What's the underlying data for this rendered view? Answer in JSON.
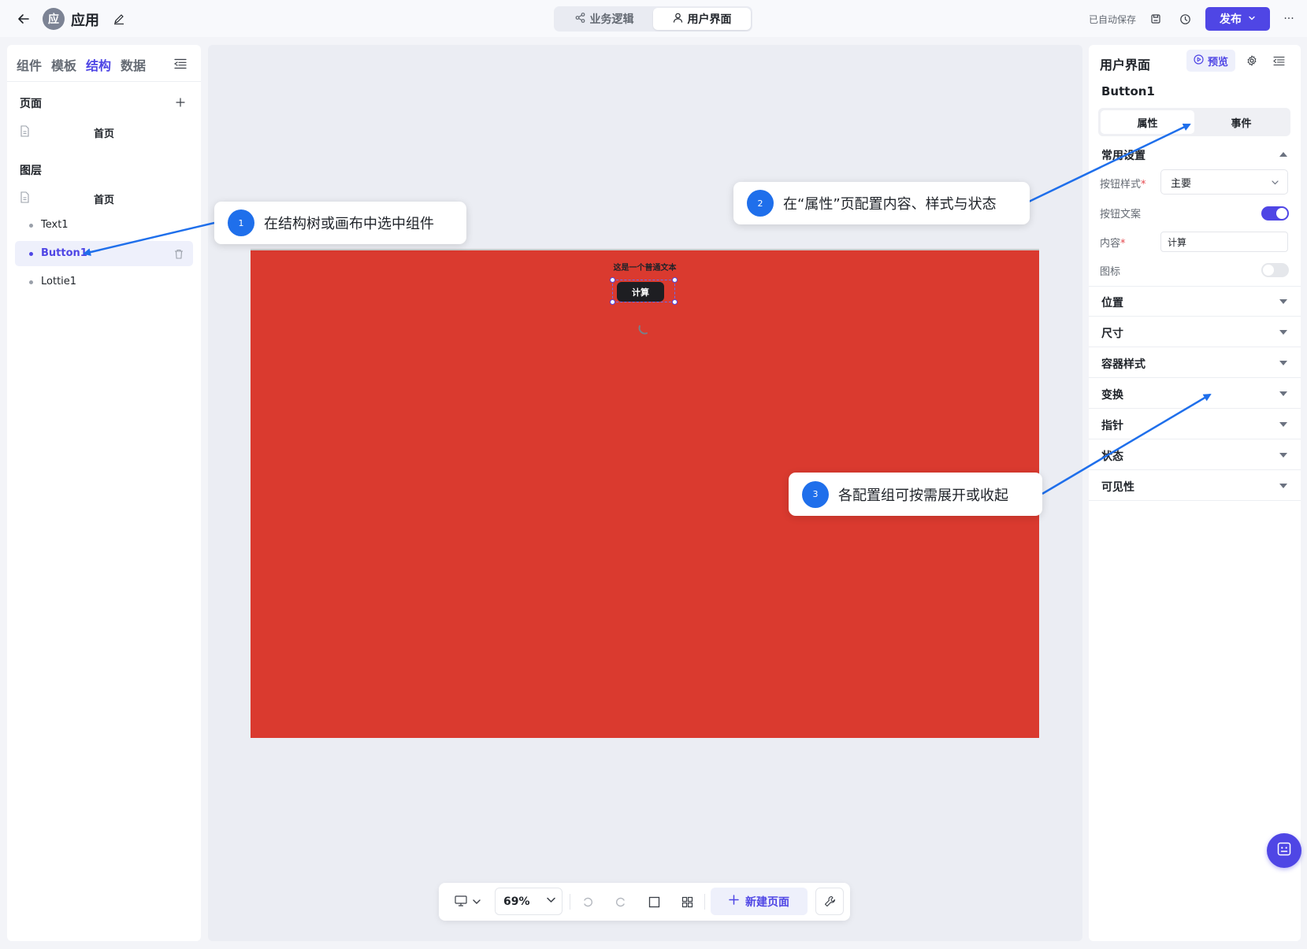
{
  "header": {
    "app_avatar": "应",
    "app_name": "应用",
    "mode_tabs": [
      {
        "label": "业务逻辑",
        "icon": "share-nodes-icon",
        "active": false
      },
      {
        "label": "用户界面",
        "icon": "user-icon",
        "active": true
      }
    ],
    "autosave": "已自动保存",
    "publish_label": "发布",
    "more_label": "···"
  },
  "left_panel": {
    "tabs": [
      {
        "label": "组件",
        "active": false
      },
      {
        "label": "模板",
        "active": false
      },
      {
        "label": "结构",
        "active": true
      },
      {
        "label": "数据",
        "active": false
      }
    ],
    "pages_title": "页面",
    "pages": [
      {
        "label": "首页"
      }
    ],
    "layers_title": "图层",
    "layer_root": "首页",
    "layers": [
      {
        "label": "Text1",
        "selected": false
      },
      {
        "label": "Button1",
        "selected": true
      },
      {
        "label": "Lottie1",
        "selected": false
      }
    ]
  },
  "canvas": {
    "text_component": "这是一个普通文本",
    "button_component": "计算",
    "background_color": "#da3a2f"
  },
  "bottom_toolbar": {
    "zoom": "69%",
    "new_page_label": "新建页面"
  },
  "right_panel": {
    "title": "用户界面",
    "preview_label": "预览",
    "component_name": "Button1",
    "prop_tabs": [
      {
        "label": "属性",
        "active": true
      },
      {
        "label": "事件",
        "active": false
      }
    ],
    "common_group": "常用设置",
    "button_style_label": "按钮样式",
    "button_style_value": "主要",
    "button_text_label": "按钮文案",
    "button_text_toggle": true,
    "content_label": "内容",
    "content_value": "计算",
    "icon_label": "图标",
    "icon_toggle": false,
    "required_mark": "*",
    "groups": [
      {
        "label": "位置"
      },
      {
        "label": "尺寸"
      },
      {
        "label": "容器样式"
      },
      {
        "label": "变换"
      },
      {
        "label": "指针"
      },
      {
        "label": "状态"
      },
      {
        "label": "可见性"
      }
    ]
  },
  "annotations": [
    {
      "number": "1",
      "text": "在结构树或画布中选中组件"
    },
    {
      "number": "2",
      "text": "在“属性”页配置内容、样式与状态"
    },
    {
      "number": "3",
      "text": "各配置组可按需展开或收起"
    }
  ],
  "colors": {
    "accent": "#4f46e5",
    "annotation_blue": "#1f6feb",
    "canvas_red": "#da3a2f"
  }
}
